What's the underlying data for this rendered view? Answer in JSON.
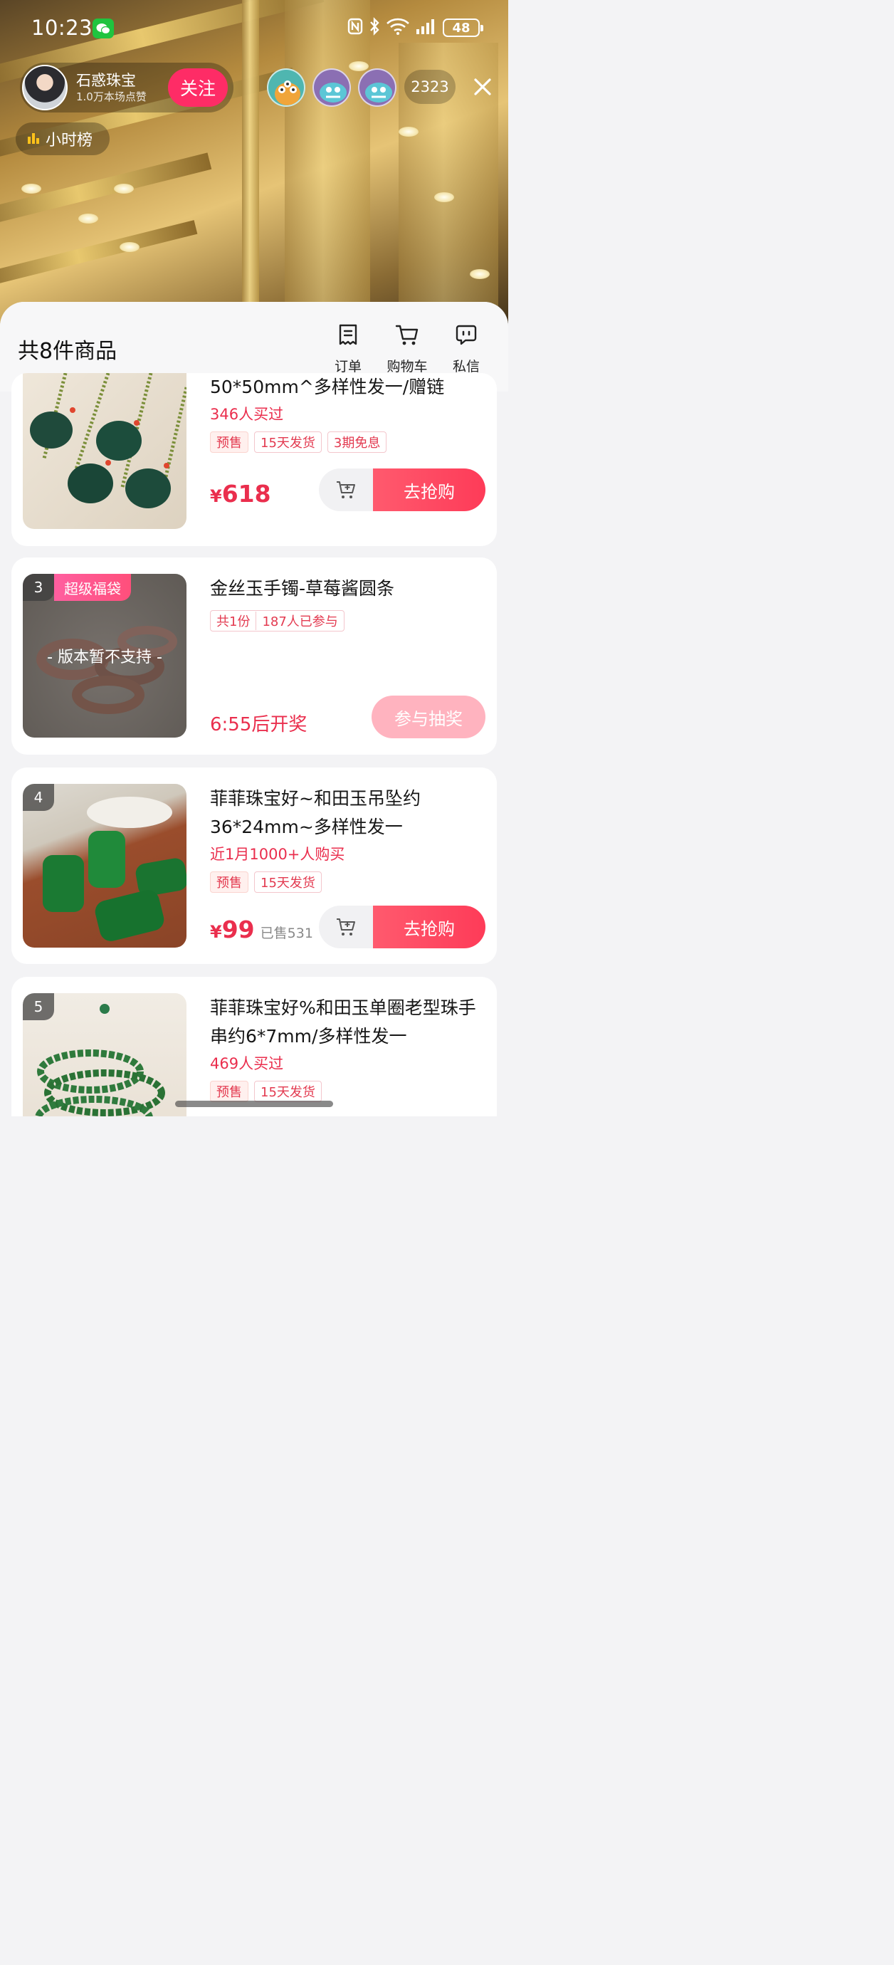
{
  "status_bar": {
    "time": "10:23",
    "battery": "48"
  },
  "host": {
    "name": "石惑珠宝",
    "likes": "1.0万本场点赞",
    "follow_label": "关注"
  },
  "viewers": {
    "count": "2323"
  },
  "rank": {
    "label": "小时榜"
  },
  "sheet": {
    "title": "共8件商品",
    "actions": [
      {
        "label": "订单",
        "icon": "order-icon"
      },
      {
        "label": "购物车",
        "icon": "cart-icon"
      },
      {
        "label": "私信",
        "icon": "message-icon"
      }
    ]
  },
  "products": [
    {
      "title": "50*50mm^多样性发一/赠链",
      "sub": "346人买过",
      "tags": [
        "预售",
        "15天发货",
        "3期免息"
      ],
      "currency": "¥",
      "price": "618",
      "button": "去抢购"
    },
    {
      "rank": "3",
      "badge": "超级福袋",
      "overlay": "- 版本暂不支持 -",
      "title": "金丝玉手镯-草莓酱圆条",
      "tags": [
        "共1份",
        "187人已参与"
      ],
      "countdown": "6:55后开奖",
      "button": "参与抽奖"
    },
    {
      "rank": "4",
      "title": "菲菲珠宝好~和田玉吊坠约36*24mm~多样性发一",
      "sub": "近1月1000+人购买",
      "tags": [
        "预售",
        "15天发货"
      ],
      "currency": "¥",
      "price": "99",
      "sold": "已售531",
      "button": "去抢购"
    },
    {
      "rank": "5",
      "title": "菲菲珠宝好%和田玉单圈老型珠手串约6*7mm/多样性发一",
      "sub": "469人买过",
      "tags": [
        "预售",
        "15天发货"
      ]
    }
  ],
  "colors": {
    "accent": "#ea2e4d",
    "follow": "#fe2c66",
    "button": "#fe3b58"
  }
}
